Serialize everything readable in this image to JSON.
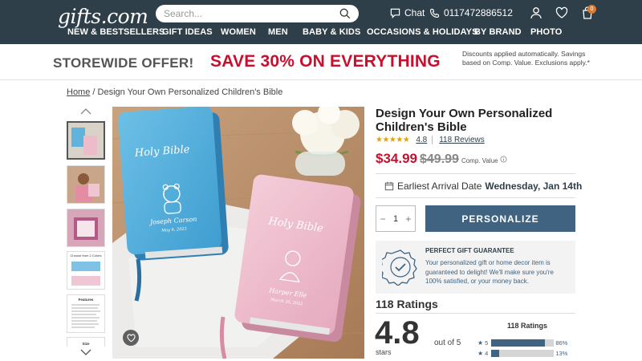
{
  "header": {
    "logo": "gifts.com",
    "search_placeholder": "Search...",
    "chat_label": "Chat",
    "phone": "0117472886512",
    "cart_count": "0",
    "bg_color": "#2f3f49"
  },
  "nav": [
    "NEW & BESTSELLERS",
    "GIFT IDEAS",
    "WOMEN",
    "MEN",
    "BABY & KIDS",
    "OCCASIONS & HOLIDAYS",
    "BY BRAND",
    "PHOTO"
  ],
  "promo": {
    "left": "STOREWIDE OFFER!",
    "middle": "SAVE 30% ON EVERYTHING",
    "right": "Discounts applied automatically. Savings based on Comp. Value. Exclusions apply.*",
    "accent_color": "#c8102e"
  },
  "breadcrumb": {
    "home": "Home",
    "separator": "/",
    "current": "Design Your Own Personalized Children's Bible"
  },
  "thumbnails": {
    "chart_thumb_title": "Choose from 2 Colors",
    "features_thumb_title": "Features",
    "size_thumb_title": "Size"
  },
  "main_image": {
    "blue_book_title": "Holy Bible",
    "blue_book_name": "Joseph Carson",
    "blue_book_date": "May 6, 2023",
    "pink_book_title": "Holy Bible",
    "pink_book_name": "Harper Elle",
    "pink_book_date": "March 20, 2022"
  },
  "product": {
    "title": "Design Your Own Personalized Children's Bible",
    "stars": "★★★★★",
    "rating": "4.8",
    "reviews_link": "118 Reviews",
    "price": "$34.99",
    "old_price": "$49.99",
    "comp_value": "Comp. Value",
    "arrival_label": "Earliest Arrival Date",
    "arrival_date": "Wednesday, Jan 14th",
    "quantity": "1",
    "minus": "−",
    "plus": "+",
    "personalize_label": "PERSONALIZE",
    "button_color": "#3f6381"
  },
  "guarantee": {
    "title": "PERFECT GIFT GUARANTEE",
    "text": "Your personalized gift or home decor item is guaranteed to delight! We'll make sure you're 100% satisfied, or your money back."
  },
  "ratings": {
    "title": "118 Ratings",
    "score": "4.8",
    "out_of": "out of 5",
    "stars_label": "stars",
    "dist_title": "118 Ratings",
    "rows": [
      {
        "star": "5",
        "pct_label": "86%",
        "fraction": 0.86
      },
      {
        "star": "4",
        "pct_label": "13%",
        "fraction": 0.13
      }
    ]
  }
}
